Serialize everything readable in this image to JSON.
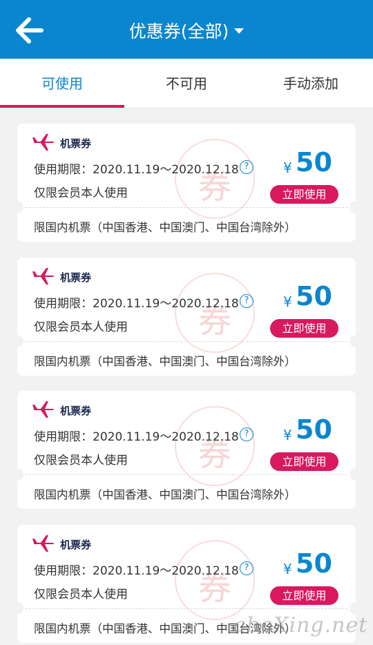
{
  "header": {
    "title": "优惠券(全部)"
  },
  "tabs": [
    {
      "label": "可使用"
    },
    {
      "label": "不可用"
    },
    {
      "label": "手动添加"
    }
  ],
  "colors": {
    "brand": "#0a86cf",
    "accent": "#d8195e"
  },
  "coupons": [
    {
      "type": "机票券",
      "validity": "使用期限：2020.11.19～2020.12.18",
      "help": "?",
      "restriction": "仅限会员本人使用",
      "currency": "¥",
      "amount": "50",
      "button": "立即使用",
      "stamp": "券",
      "scope": "限国内机票（中国香港、中国澳门、中国台湾除外）"
    },
    {
      "type": "机票券",
      "validity": "使用期限：2020.11.19～2020.12.18",
      "help": "?",
      "restriction": "仅限会员本人使用",
      "currency": "¥",
      "amount": "50",
      "button": "立即使用",
      "stamp": "券",
      "scope": "限国内机票（中国香港、中国澳门、中国台湾除外）"
    },
    {
      "type": "机票券",
      "validity": "使用期限：2020.11.19～2020.12.18",
      "help": "?",
      "restriction": "仅限会员本人使用",
      "currency": "¥",
      "amount": "50",
      "button": "立即使用",
      "stamp": "券",
      "scope": "限国内机票（中国香港、中国澳门、中国台湾除外）"
    },
    {
      "type": "机票券",
      "validity": "使用期限：2020.11.19～2020.12.18",
      "help": "?",
      "restriction": "仅限会员本人使用",
      "currency": "¥",
      "amount": "50",
      "button": "立即使用",
      "stamp": "券",
      "scope": "限国内机票（中国香港、中国澳门、中国台湾除外）"
    }
  ],
  "watermark": "aboXing.net"
}
